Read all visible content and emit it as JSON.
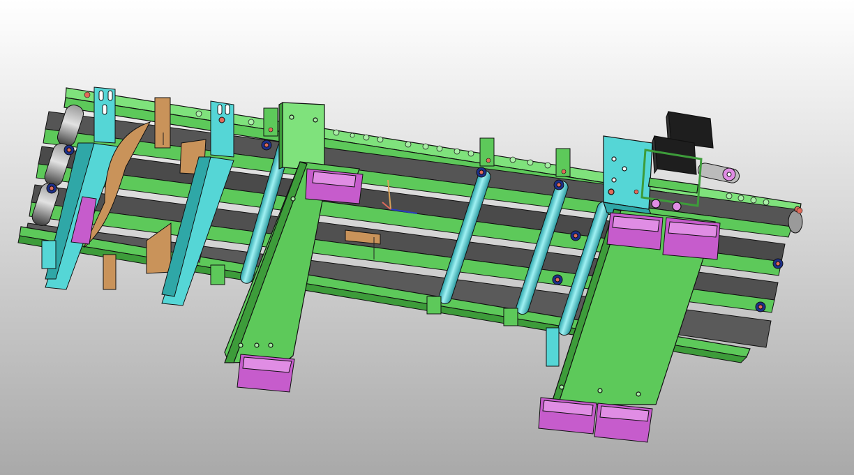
{
  "viewport": {
    "background_top": "#ffffff",
    "background_bottom": "#a9a9a9",
    "triad_visible": true
  },
  "colors": {
    "frame_green": "#5dc95a",
    "frame_green_light": "#7fe27c",
    "frame_green_dark": "#3d9c3a",
    "bracket_cyan": "#55d6d6",
    "bracket_cyan_dark": "#2fa7a7",
    "roller_cyan": "#58cfd3",
    "belt_gray": "#4a4a4a",
    "belt_gray_light": "#6a6a6a",
    "guide_magenta": "#c65ccc",
    "guide_magenta_light": "#e08de4",
    "plate_tan": "#c9935a",
    "motor_black": "#1e1e1e",
    "bolt_red": "#e06a5a",
    "bearing_blue": "#1c2f8a",
    "outline": "#111111"
  },
  "model": {
    "components": [
      "conveyor-frame",
      "belt-lanes",
      "idler-rollers",
      "cross-rollers",
      "cyan-brackets",
      "tan-guide-plates",
      "slider-plates",
      "magenta-linear-guides",
      "stepper-motors",
      "belt-drive"
    ]
  }
}
